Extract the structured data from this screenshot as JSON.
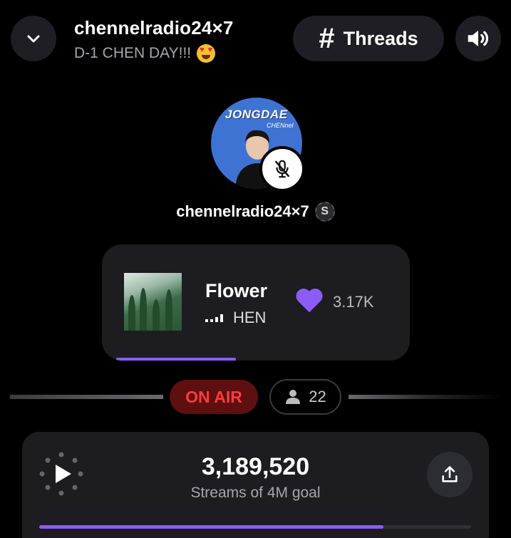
{
  "header": {
    "title": "chennelradio24×7",
    "subtitle": "D-1 CHEN DAY!!!",
    "threads_label": "Threads"
  },
  "host": {
    "avatar_text": "JONGDAE",
    "avatar_subtext": "CHENnel",
    "name": "chennelradio24×7",
    "badge": "S"
  },
  "now_playing": {
    "title": "Flower",
    "artist": "HEN",
    "likes": "3.17K",
    "progress": 0.39
  },
  "status": {
    "on_air": "ON AIR",
    "listeners": "22"
  },
  "streams": {
    "count": "3,189,520",
    "goal_text": "Streams of 4M goal",
    "progress": 0.797
  },
  "colors": {
    "accent": "#8b5cf6",
    "on_air": "#ff3b3b",
    "card": "#1c1c21"
  }
}
